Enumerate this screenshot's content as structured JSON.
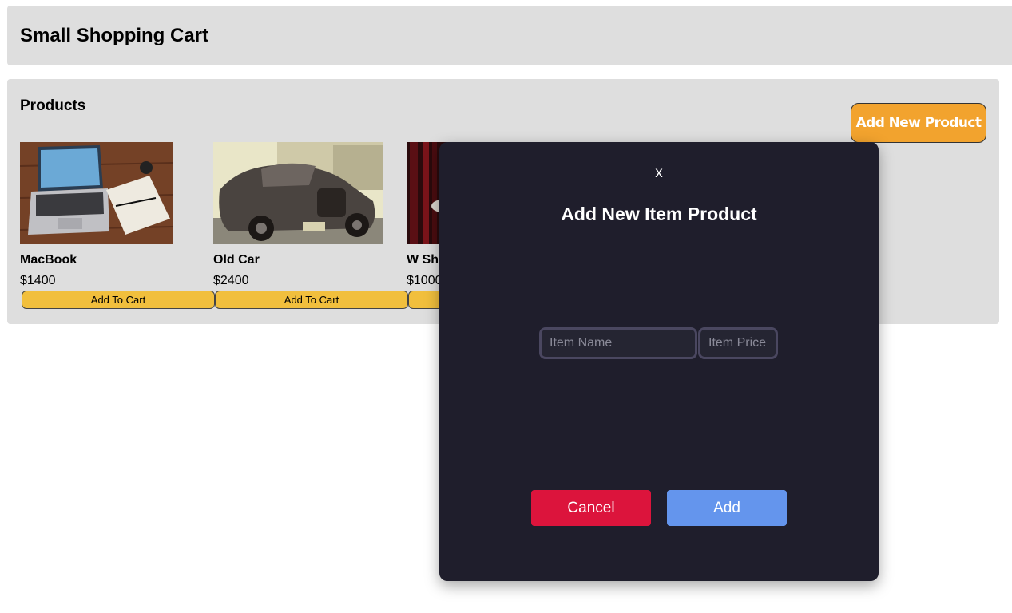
{
  "header": {
    "title": "Small Shopping Cart"
  },
  "products": {
    "heading": "Products",
    "add_new_label": "Add New Product",
    "add_to_cart_label": "Add To Cart",
    "items": [
      {
        "name": "MacBook",
        "price": "$1400",
        "image": "laptop-photo"
      },
      {
        "name": "Old Car",
        "price": "$2400",
        "image": "vintage-car-photo"
      },
      {
        "name": "W Sh",
        "price": "$1000",
        "image": "shoe-photo"
      }
    ]
  },
  "modal": {
    "close_label": "x",
    "title": "Add New Item Product",
    "name_placeholder": "Item Name",
    "price_placeholder": "Item Price",
    "cancel_label": "Cancel",
    "add_label": "Add"
  },
  "colors": {
    "accent_orange": "#f2a32e",
    "cart_button_yellow": "#f1bf3d",
    "modal_bg": "#1f1e2c",
    "cancel_red": "#dc143c",
    "add_blue": "#6495ed"
  }
}
